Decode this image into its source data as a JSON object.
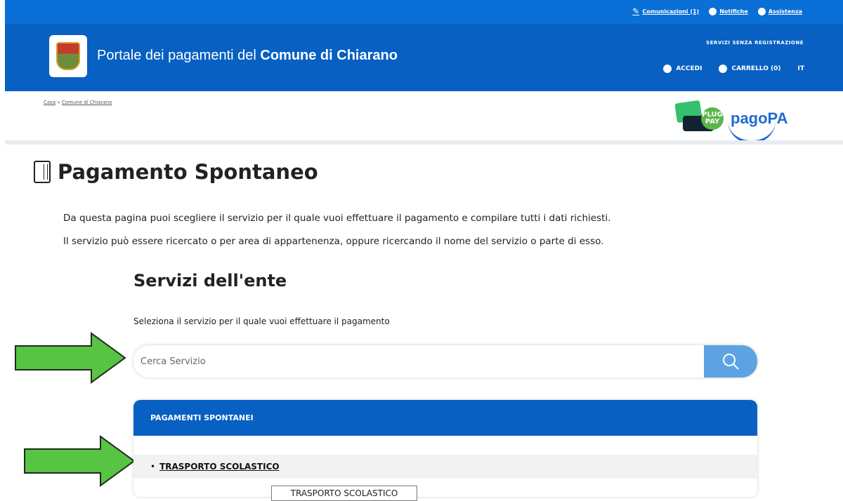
{
  "header": {
    "utility": {
      "communications": "Comunicazioni (1)",
      "notifications": "Notifiche",
      "assistance": "Assistenza"
    },
    "brand_prefix": "Portale dei pagamenti del ",
    "brand_bold": "Comune di Chiarano",
    "no_registration": "SERVIZI SENZA REGISTRAZIONE",
    "login": "ACCEDI",
    "cart": "CARRELLO (0)",
    "language": "IT"
  },
  "breadcrumb": {
    "home": "Casa",
    "separator": " » ",
    "current": "Comune di Chiarano"
  },
  "partners": {
    "plugpay": "PLUG PAY",
    "pagopa": "pagoPA"
  },
  "page": {
    "title": "Pagamento Spontaneo",
    "desc1": "Da questa pagina puoi scegliere il servizio per il quale vuoi effettuare il pagamento e compilare tutti i dati richiesti.",
    "desc2": "Il servizio può essere ricercato o per area di appartenenza, oppure ricercando il nome del servizio o parte di esso."
  },
  "services": {
    "title": "Servizi dell'ente",
    "subtitle": "Seleziona il servizio per il quale vuoi effettuare il pagamento",
    "search_placeholder": "Cerca Servizio",
    "panel_title": "PAGAMENTI SPONTANEI",
    "bullet": "•",
    "item": "TRASPORTO SCOLASTICO",
    "tooltip": "TRASPORTO SCOLASTICO"
  },
  "colors": {
    "header_blue": "#0760c2",
    "top_blue": "#0a6fd6",
    "search_button": "#5da3e3",
    "arrow_green": "#57c443"
  }
}
